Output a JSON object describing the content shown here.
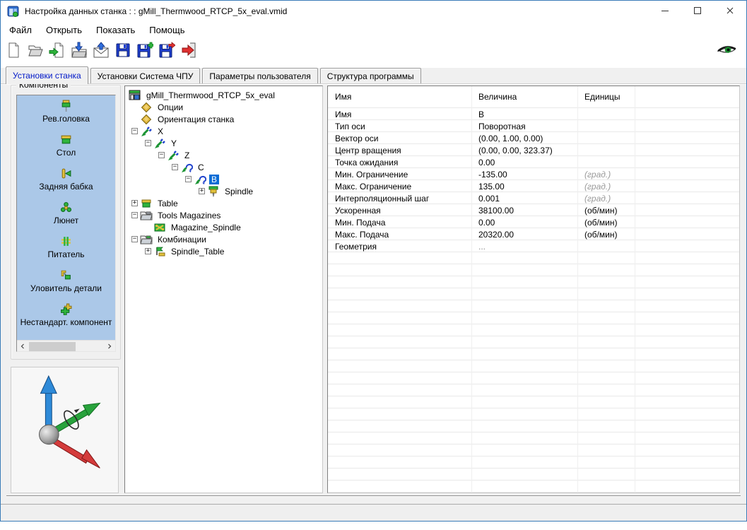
{
  "window": {
    "title": "Настройка данных станка : : gMill_Thermwood_RTCP_5x_eval.vmid",
    "app_icon": "app-icon",
    "controls": [
      "minimize-icon",
      "maximize-icon",
      "close-icon"
    ]
  },
  "menu": {
    "items": [
      "Файл",
      "Открыть",
      "Показать",
      "Помощь"
    ]
  },
  "toolbar": {
    "icons": [
      "new-document-icon",
      "open-file-icon",
      "import-file-icon",
      "load-into-folder-icon",
      "mail-import-icon",
      "save-icon",
      "save-add-icon",
      "save-export-icon",
      "exit-icon"
    ],
    "right_icon": "eye-icon"
  },
  "tabs": [
    {
      "label": "Установки станка",
      "active": true
    },
    {
      "label": "Установки Система ЧПУ"
    },
    {
      "label": "Параметры пользователя"
    },
    {
      "label": "Структура программы"
    }
  ],
  "components": {
    "group_label": "Компоненты",
    "items": [
      {
        "label": "Рев.головка",
        "icon": "turret-head-icon"
      },
      {
        "label": "Стол",
        "icon": "table-icon"
      },
      {
        "label": "Задняя бабка",
        "icon": "tailstock-icon"
      },
      {
        "label": "Люнет",
        "icon": "steady-rest-icon"
      },
      {
        "label": "Питатель",
        "icon": "feeder-icon"
      },
      {
        "label": "Уловитель детали",
        "icon": "part-catcher-icon"
      },
      {
        "label": "Нестандарт. компонент",
        "icon": "custom-component-icon"
      }
    ]
  },
  "tree": {
    "nodes": [
      {
        "label": "gMill_Thermwood_RTCP_5x_eval",
        "level": 0,
        "icon": "machine-icon"
      },
      {
        "label": "Опции",
        "level": 1,
        "icon": "option-icon"
      },
      {
        "label": "Ориентация станка",
        "level": 1,
        "icon": "option-icon"
      },
      {
        "label": "X",
        "level": 1,
        "toggle": "minus",
        "icon": "linear-axis-icon"
      },
      {
        "label": "Y",
        "level": 2,
        "toggle": "minus",
        "icon": "linear-axis-icon"
      },
      {
        "label": "Z",
        "level": 3,
        "toggle": "minus",
        "icon": "linear-axis-icon"
      },
      {
        "label": "C",
        "level": 4,
        "toggle": "minus",
        "icon": "rotary-axis-icon"
      },
      {
        "label": "B",
        "level": 5,
        "toggle": "minus",
        "icon": "rotary-axis-icon",
        "selected": true
      },
      {
        "label": "Spindle",
        "level": 6,
        "toggle": "plus",
        "icon": "spindle-icon"
      },
      {
        "label": "Table",
        "level": 1,
        "toggle": "plus",
        "icon": "table-icon"
      },
      {
        "label": "Tools Magazines",
        "level": 1,
        "toggle": "minus",
        "icon": "folder-tools-icon"
      },
      {
        "label": "Magazine_Spindle",
        "level": 2,
        "icon": "magazine-icon"
      },
      {
        "label": "Комбинации",
        "level": 1,
        "toggle": "minus",
        "icon": "folder-combo-icon"
      },
      {
        "label": "Spindle_Table",
        "level": 2,
        "toggle": "plus",
        "icon": "combination-icon"
      }
    ]
  },
  "properties": {
    "columns": [
      "Имя",
      "Величина",
      "Единицы"
    ],
    "rows": [
      {
        "name": "Имя",
        "value": "B",
        "units": ""
      },
      {
        "name": "Тип оси",
        "value": "Поворотная",
        "units": ""
      },
      {
        "name": "Вектор оси",
        "value": "(0.00, 1.00, 0.00)",
        "units": ""
      },
      {
        "name": "Центр вращения",
        "value": "(0.00, 0.00, 323.37)",
        "units": ""
      },
      {
        "name": "Точка ожидания",
        "value": "0.00",
        "units": ""
      },
      {
        "name": "Мин. Ограничение",
        "value": "-135.00",
        "units": "(град.)",
        "units_muted": true
      },
      {
        "name": "Макс. Ограничение",
        "value": "135.00",
        "units": "(град.)",
        "units_muted": true
      },
      {
        "name": "Интерполяционный шаг",
        "value": "0.001",
        "units": "(град.)",
        "units_muted": true
      },
      {
        "name": "Ускоренная",
        "value": "38100.00",
        "units": "(об/мин)"
      },
      {
        "name": "Мин. Подача",
        "value": "0.00",
        "units": "(об/мин)"
      },
      {
        "name": "Макс. Подача",
        "value": "20320.00",
        "units": "(об/мин)"
      },
      {
        "name": "Геометрия",
        "value": "...",
        "units": "",
        "value_muted": true
      }
    ]
  },
  "colors": {
    "window_border": "#3a7cb8",
    "titlebar_bg": "#ffffff",
    "client_bg": "#f0f0f0",
    "listbox_bg": "#abc8e8",
    "selection": "#0a6cd6",
    "tab_active_text": "#0018c8",
    "units_muted": "#9a9a9a"
  }
}
